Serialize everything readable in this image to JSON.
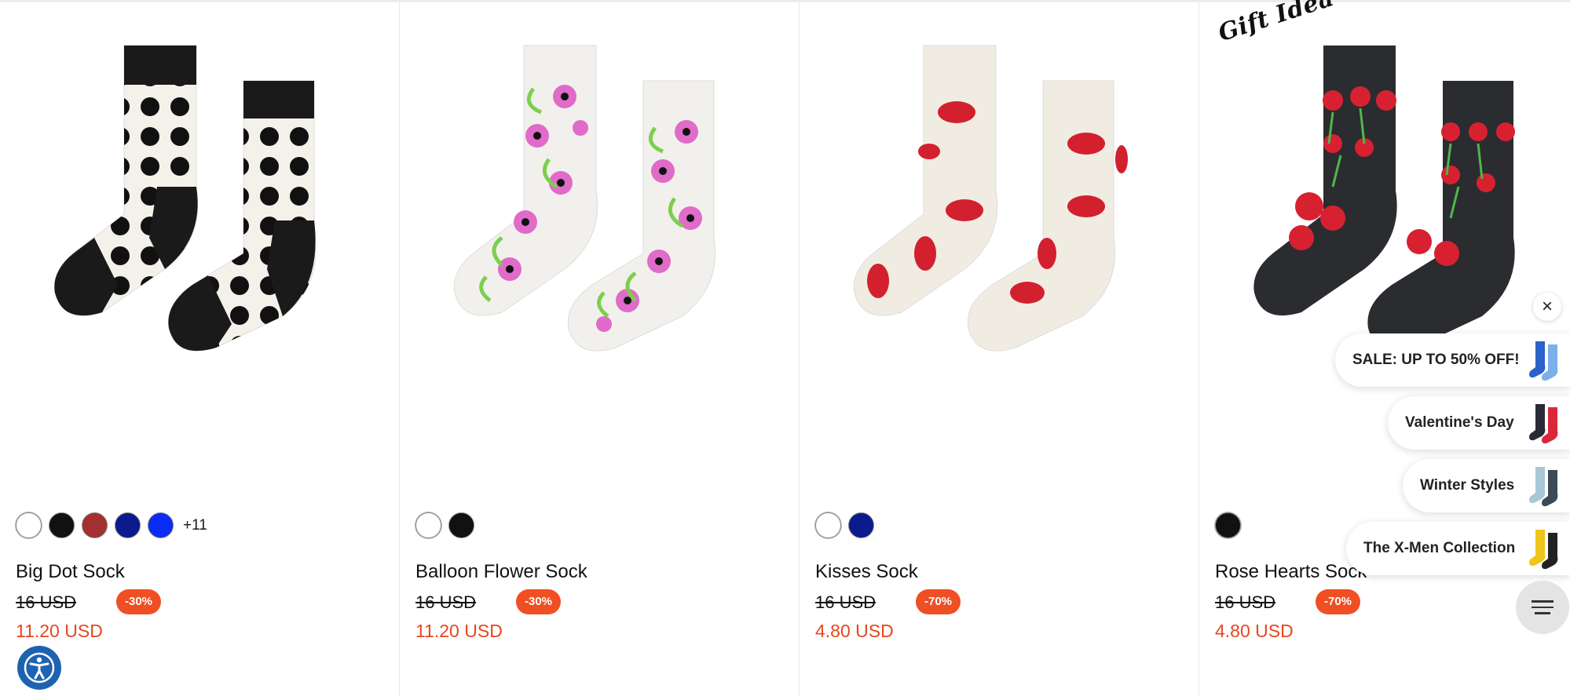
{
  "products": [
    {
      "name": "Big Dot Sock",
      "old_price": "16 USD",
      "discount": "-30%",
      "new_price": "11.20 USD",
      "swatches": [
        "#ffffff",
        "#111111",
        "#a33030",
        "#0b1a8c",
        "#0a2cf5"
      ],
      "more_colors": "+11",
      "badge": ""
    },
    {
      "name": "Balloon Flower Sock",
      "old_price": "16 USD",
      "discount": "-30%",
      "new_price": "11.20 USD",
      "swatches": [
        "#ffffff",
        "#111111"
      ],
      "more_colors": "",
      "badge": ""
    },
    {
      "name": "Kisses Sock",
      "old_price": "16 USD",
      "discount": "-70%",
      "new_price": "4.80 USD",
      "swatches": [
        "#ffffff",
        "#0b1a8c"
      ],
      "more_colors": "",
      "badge": ""
    },
    {
      "name": "Rose Hearts Sock",
      "old_price": "16 USD",
      "discount": "-70%",
      "new_price": "4.80 USD",
      "swatches": [
        "#111111"
      ],
      "more_colors": "",
      "badge": "Gift Idea"
    }
  ],
  "promo_widget": {
    "close_icon": "close-icon",
    "items": [
      {
        "label": "SALE: UP TO 50% OFF!",
        "thumb_colors": [
          "#2a63c8",
          "#7bb0ea"
        ]
      },
      {
        "label": "Valentine's Day",
        "thumb_colors": [
          "#2a2a35",
          "#d8283a"
        ]
      },
      {
        "label": "Winter Styles",
        "thumb_colors": [
          "#a8c8d8",
          "#3d4a55"
        ]
      },
      {
        "label": "The X-Men Collection",
        "thumb_colors": [
          "#f0c51a",
          "#222222"
        ]
      }
    ],
    "menu_icon": "menu-icon"
  },
  "accessibility_icon": "accessibility-icon",
  "colors": {
    "sale_red": "#f04e23",
    "price_red": "#e8461c",
    "accessibility_blue": "#1f63b0"
  }
}
